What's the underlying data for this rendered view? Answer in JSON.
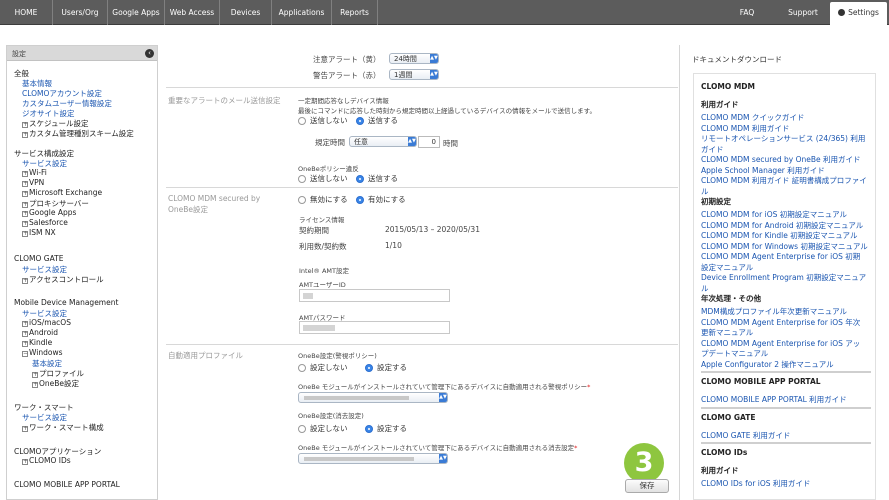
{
  "nav": {
    "items": [
      "HOME",
      "Users/Org",
      "Google Apps",
      "Web Access",
      "Devices",
      "Applications",
      "Reports"
    ],
    "right_items": [
      "FAQ",
      "Support"
    ],
    "settings_tab": "Settings"
  },
  "sidebar": {
    "header": "設定",
    "items": [
      {
        "text": "全般",
        "kind": "h"
      },
      {
        "text": "基本情報",
        "kind": "l"
      },
      {
        "text": "CLOMOアカウント設定",
        "kind": "l"
      },
      {
        "text": "カスタムユーザー情報設定",
        "kind": "l"
      },
      {
        "text": "ジオサイト設定",
        "kind": "l"
      },
      {
        "text": "スケジュール設定",
        "kind": "d",
        "toggle": "+"
      },
      {
        "text": "カスタム管理種別スキーム設定",
        "kind": "d",
        "toggle": "+"
      },
      {
        "text": "サービス構成設定",
        "kind": "h"
      },
      {
        "text": "サービス設定",
        "kind": "l"
      },
      {
        "text": "Wi-Fi",
        "kind": "d",
        "toggle": "+"
      },
      {
        "text": "VPN",
        "kind": "d",
        "toggle": "+"
      },
      {
        "text": "Microsoft Exchange",
        "kind": "d",
        "toggle": "+"
      },
      {
        "text": "プロキシサーバー",
        "kind": "d",
        "toggle": "+"
      },
      {
        "text": "Google Apps",
        "kind": "d",
        "toggle": "+"
      },
      {
        "text": "Salesforce",
        "kind": "d",
        "toggle": "+"
      },
      {
        "text": "ISM NX",
        "kind": "d",
        "toggle": "+"
      },
      {
        "text": "CLOMO GATE",
        "kind": "h"
      },
      {
        "text": "サービス設定",
        "kind": "l"
      },
      {
        "text": "アクセスコントロール",
        "kind": "d",
        "toggle": "+"
      },
      {
        "text": "Mobile Device Management",
        "kind": "h"
      },
      {
        "text": "サービス設定",
        "kind": "l"
      },
      {
        "text": "iOS/macOS",
        "kind": "d",
        "toggle": "+"
      },
      {
        "text": "Android",
        "kind": "d",
        "toggle": "+"
      },
      {
        "text": "Kindle",
        "kind": "d",
        "toggle": "+"
      },
      {
        "text": "Windows",
        "kind": "d",
        "toggle": "−"
      },
      {
        "text": "基本設定",
        "kind": "l"
      },
      {
        "text": "プロファイル",
        "kind": "d",
        "toggle": "+"
      },
      {
        "text": "OneBe設定",
        "kind": "d",
        "toggle": "+"
      },
      {
        "text": "ワーク・スマート",
        "kind": "h"
      },
      {
        "text": "サービス設定",
        "kind": "l"
      },
      {
        "text": "ワーク・スマート構成",
        "kind": "d",
        "toggle": "+"
      },
      {
        "text": "CLOMOアプリケーション",
        "kind": "h"
      },
      {
        "text": "CLOMO IDs",
        "kind": "d",
        "toggle": "+"
      },
      {
        "text": "CLOMO MOBILE APP PORTAL",
        "kind": "h"
      }
    ]
  },
  "main": {
    "alert_yellow_label": "注意アラート（黄）",
    "alert_yellow_value": "24時間",
    "alert_red_label": "警告アラート（赤）",
    "alert_red_value": "1週間",
    "mail_section_label": "重要なアラートのメール送信設定",
    "mail_sub_title": "一定期間応答なしデバイス情報",
    "mail_desc": "最後にコマンドに応答した時刻から規定時間以上経過しているデバイスの情報をメールで送信します。",
    "radio_no_send": "送信しない",
    "radio_send": "送信する",
    "regular_time_label": "規定時間",
    "regular_time_select": "任意",
    "regular_time_value": "0",
    "hours_unit": "時間",
    "onebe_policy_label": "OneBeポリシー違反",
    "onebe_no_send": "送信しない",
    "onebe_send": "送信する",
    "secured_label": "CLOMO MDM secured by",
    "secured_label2": "OneBe設定",
    "disable": "無効にする",
    "enable": "有効にする",
    "license_info": "ライセンス情報",
    "contract_period_label": "契約期間",
    "contract_period_value": "2015/05/13 – 2020/05/31",
    "usage_label": "利用数/契約数",
    "usage_value": "1/10",
    "amt_settings": "Intel® AMT設定",
    "amt_user_label": "AMTユーザーID",
    "amt_password_label": "AMTパスワード",
    "auto_profile_label": "自動適用プロファイル",
    "policy_setting_label": "OneBe設定(警視ポリシー)",
    "policy_no_set": "設定しない",
    "policy_set": "設定する",
    "policy_desc": "OneBe モジュールがインストールされていて管理下にあるデバイスに自動適用される警視ポリシー",
    "erase_setting_label": "OneBe設定(消去設定)",
    "erase_no_set": "設定しない",
    "erase_set": "設定する",
    "erase_desc": "OneBe モジュールがインストールされていて管理下にあるデバイスに自動適用される消去設定",
    "required_mark": "*",
    "save_button": "保存",
    "step_badge": "3"
  },
  "downloads": {
    "title": "ドキュメントダウンロード",
    "entries": [
      {
        "text": "CLOMO MDM",
        "kind": "sec"
      },
      {
        "text": "利用ガイド",
        "kind": "sub"
      },
      {
        "text": "CLOMO MDM クイックガイド",
        "kind": "lnk"
      },
      {
        "text": "CLOMO MDM 利用ガイド",
        "kind": "lnk"
      },
      {
        "text": "リモートオペレーションサービス (24/365) 利用",
        "kind": "lnk"
      },
      {
        "text": "ガイド",
        "kind": "lnk"
      },
      {
        "text": "CLOMO MDM secured by OneBe 利用ガイド",
        "kind": "lnk"
      },
      {
        "text": "Apple School Manager 利用ガイド",
        "kind": "lnk"
      },
      {
        "text": "CLOMO MDM 利用ガイド 証明書構成プロファイ",
        "kind": "lnk"
      },
      {
        "text": "ル",
        "kind": "lnk"
      },
      {
        "text": "初期設定",
        "kind": "sub"
      },
      {
        "text": "CLOMO MDM for iOS 初期設定マニュアル",
        "kind": "lnk"
      },
      {
        "text": "CLOMO MDM for Android 初期設定マニュアル",
        "kind": "lnk"
      },
      {
        "text": "CLOMO MDM for Kindle 初期設定マニュアル",
        "kind": "lnk"
      },
      {
        "text": "CLOMO MDM for Windows 初期設定マニュアル",
        "kind": "lnk"
      },
      {
        "text": "CLOMO MDM Agent Enterprise for iOS 初期",
        "kind": "lnk"
      },
      {
        "text": "設定マニュアル",
        "kind": "lnk"
      },
      {
        "text": "Device Enrollment Program 初期設定マニュア",
        "kind": "lnk"
      },
      {
        "text": "ル",
        "kind": "lnk"
      },
      {
        "text": "年次処理・その他",
        "kind": "sub"
      },
      {
        "text": "MDM構成プロファイル年次更新マニュアル",
        "kind": "lnk"
      },
      {
        "text": "CLOMO MDM Agent Enterprise for iOS 年次",
        "kind": "lnk"
      },
      {
        "text": "更新マニュアル",
        "kind": "lnk"
      },
      {
        "text": "CLOMO MDM Agent Enterprise for iOS アッ",
        "kind": "lnk"
      },
      {
        "text": "プデートマニュアル",
        "kind": "lnk"
      },
      {
        "text": "Apple Configurator 2 操作マニュアル",
        "kind": "lnk"
      },
      {
        "text": "CLOMO MOBILE APP PORTAL",
        "kind": "sec"
      },
      {
        "text": "CLOMO MOBILE APP PORTAL 利用ガイド",
        "kind": "lnk"
      },
      {
        "text": "CLOMO GATE",
        "kind": "sec"
      },
      {
        "text": "CLOMO GATE 利用ガイド",
        "kind": "lnk"
      },
      {
        "text": "CLOMO IDs",
        "kind": "sec"
      },
      {
        "text": "利用ガイド",
        "kind": "sub"
      },
      {
        "text": "CLOMO IDs for iOS 利用ガイド",
        "kind": "lnk"
      }
    ]
  },
  "colors": {
    "nav_bg": "#5c5c5c",
    "link": "#1a55b0",
    "badge": "#8ec63f",
    "radio_on": "#3a86e8"
  }
}
